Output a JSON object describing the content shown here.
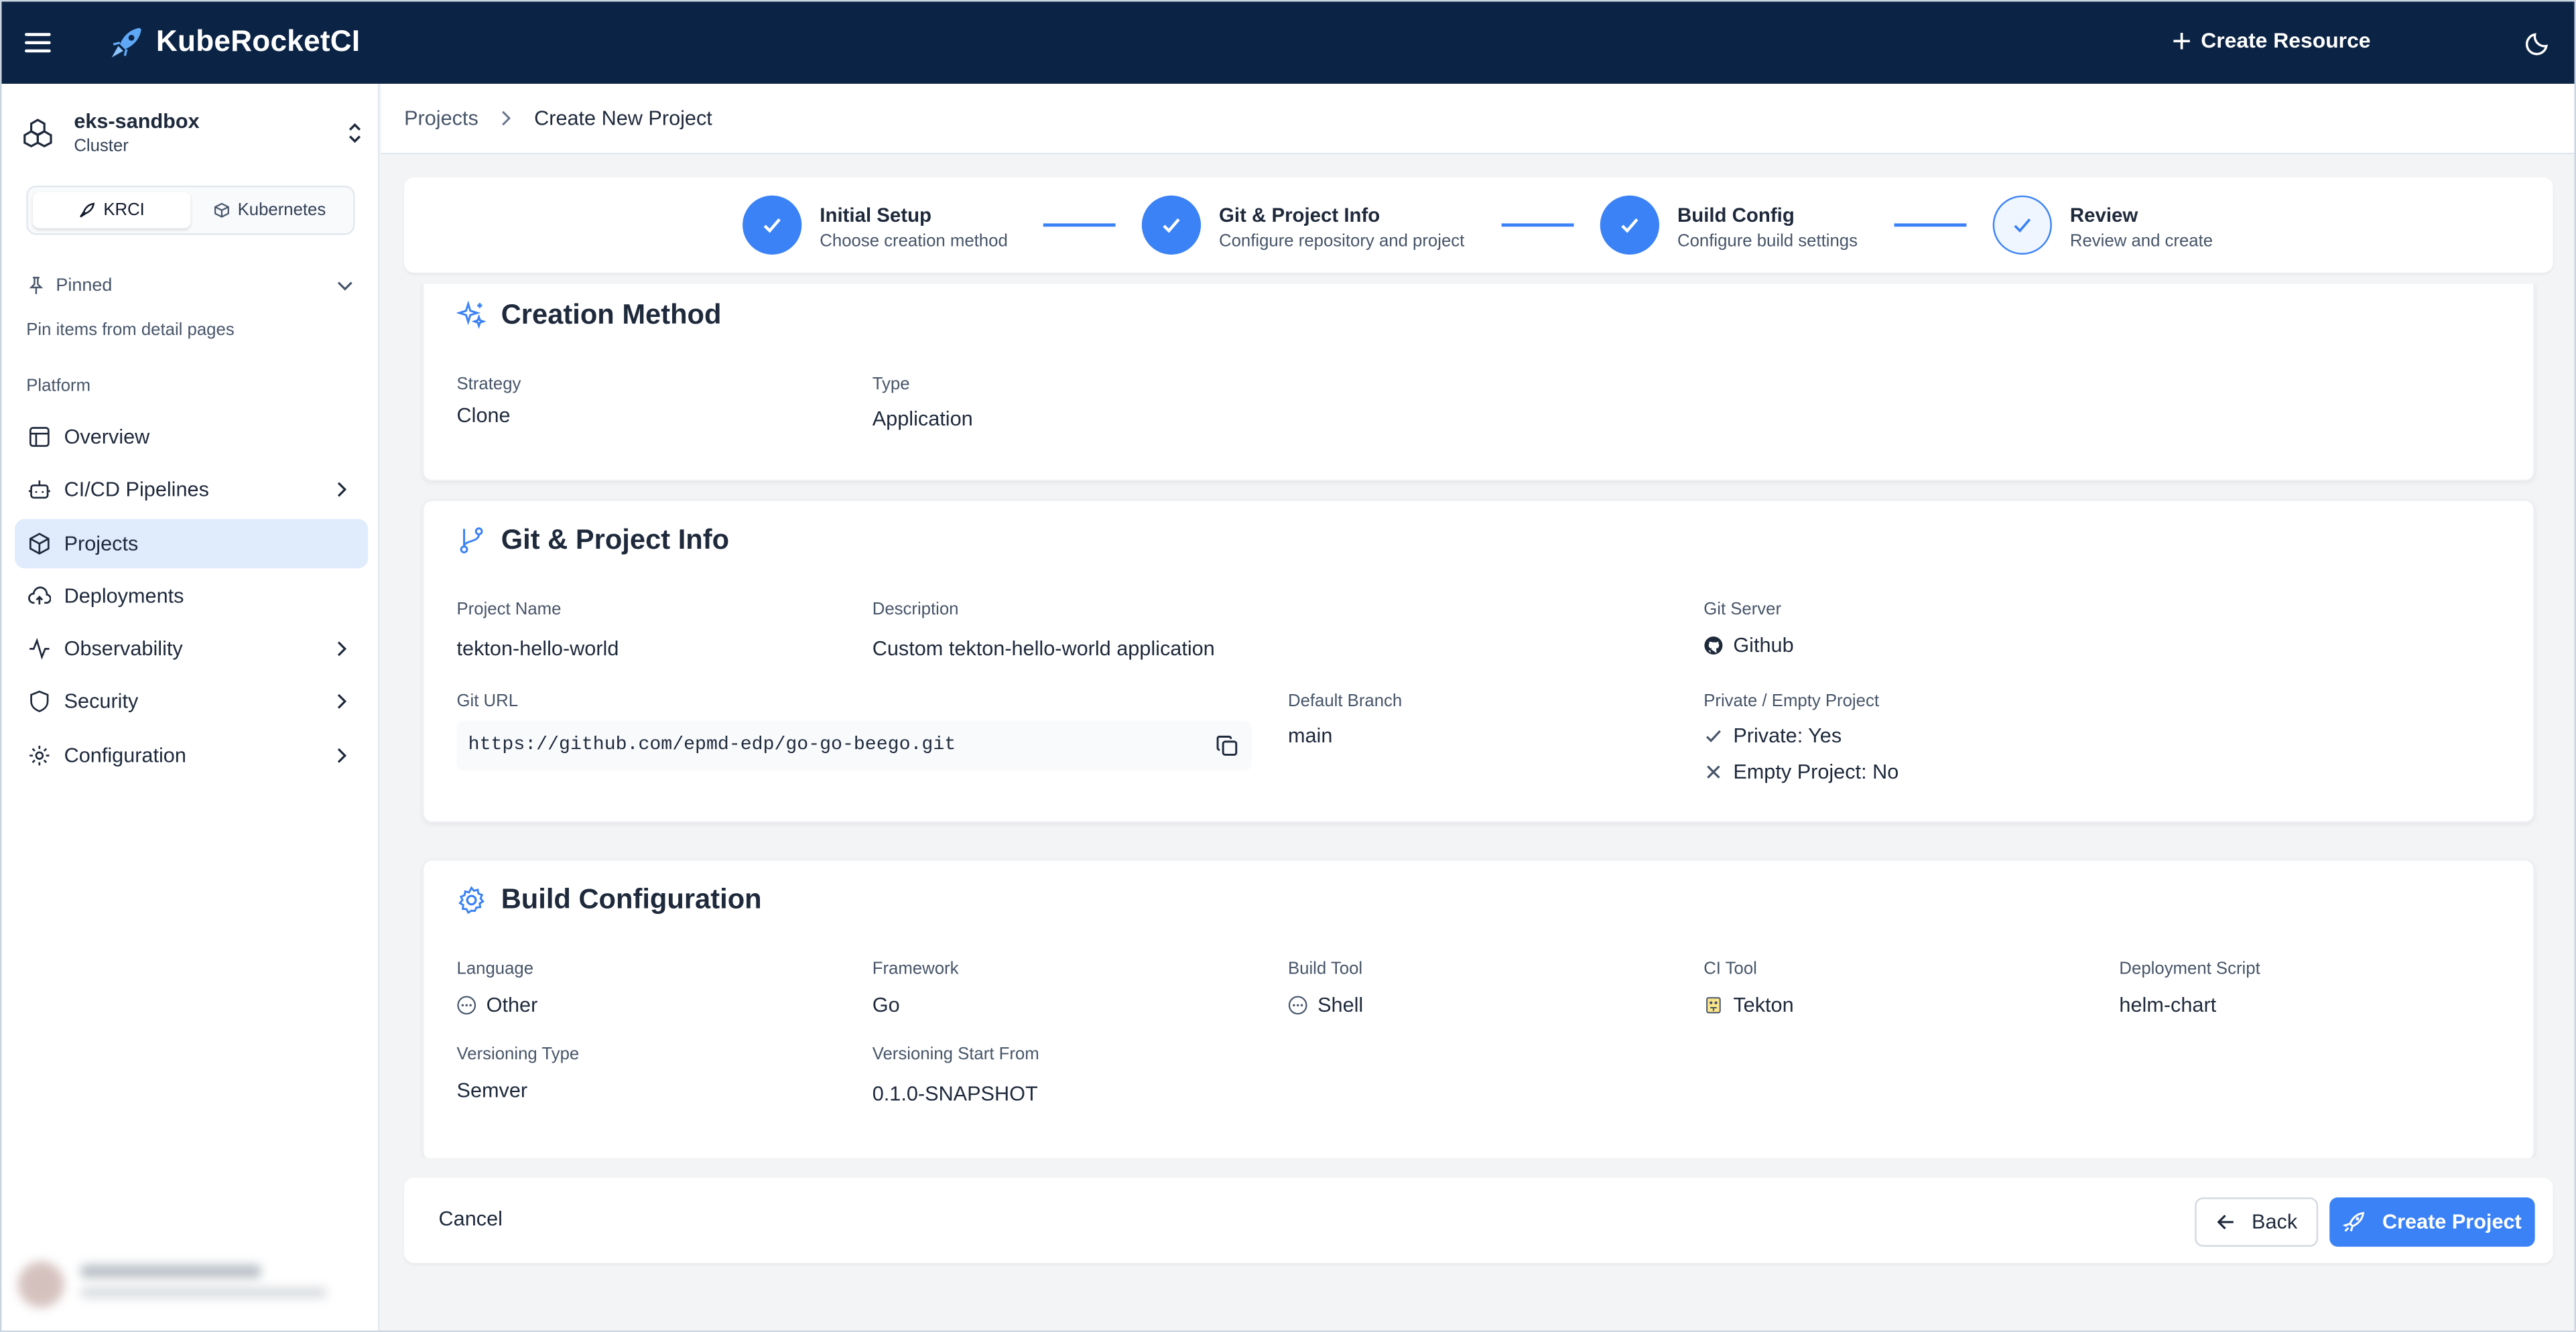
{
  "app": {
    "title": "KubeRocketCI",
    "create_resource": "Create Resource"
  },
  "cluster": {
    "name": "eks-sandbox",
    "type": "Cluster"
  },
  "mode_tabs": [
    {
      "label": "KRCI",
      "active": true
    },
    {
      "label": "Kubernetes",
      "active": false
    }
  ],
  "sidebar": {
    "pinned_label": "Pinned",
    "pinned_hint": "Pin items from detail pages",
    "section_label": "Platform",
    "items": [
      {
        "label": "Overview",
        "icon": "layout-icon",
        "has_children": false,
        "active": false
      },
      {
        "label": "CI/CD Pipelines",
        "icon": "bot-icon",
        "has_children": true,
        "active": false
      },
      {
        "label": "Projects",
        "icon": "box-icon",
        "has_children": false,
        "active": true
      },
      {
        "label": "Deployments",
        "icon": "cloud-upload-icon",
        "has_children": false,
        "active": false
      },
      {
        "label": "Observability",
        "icon": "activity-icon",
        "has_children": true,
        "active": false
      },
      {
        "label": "Security",
        "icon": "shield-icon",
        "has_children": true,
        "active": false
      },
      {
        "label": "Configuration",
        "icon": "gear-icon",
        "has_children": true,
        "active": false
      }
    ]
  },
  "breadcrumb": {
    "parent": "Projects",
    "current": "Create New Project"
  },
  "steps": [
    {
      "title": "Initial Setup",
      "subtitle": "Choose creation method",
      "state": "complete"
    },
    {
      "title": "Git & Project Info",
      "subtitle": "Configure repository and project",
      "state": "complete"
    },
    {
      "title": "Build Config",
      "subtitle": "Configure build settings",
      "state": "complete"
    },
    {
      "title": "Review",
      "subtitle": "Review and create",
      "state": "current"
    }
  ],
  "creation_method": {
    "title": "Creation Method",
    "strategy_label": "Strategy",
    "strategy": "Clone",
    "type_label": "Type",
    "type": "Application"
  },
  "git_info": {
    "title": "Git & Project Info",
    "project_name_label": "Project Name",
    "project_name": "tekton-hello-world",
    "description_label": "Description",
    "description": "Custom tekton-hello-world application",
    "git_server_label": "Git Server",
    "git_server": "Github",
    "git_url_label": "Git URL",
    "git_url": "https://github.com/epmd-edp/go-go-beego.git",
    "default_branch_label": "Default Branch",
    "default_branch": "main",
    "private_empty_label": "Private / Empty Project",
    "private": "Private: Yes",
    "empty": "Empty Project: No"
  },
  "build_config": {
    "title": "Build Configuration",
    "language_label": "Language",
    "language": "Other",
    "framework_label": "Framework",
    "framework": "Go",
    "build_tool_label": "Build Tool",
    "build_tool": "Shell",
    "ci_tool_label": "CI Tool",
    "ci_tool": "Tekton",
    "deployment_script_label": "Deployment Script",
    "deployment_script": "helm-chart",
    "versioning_type_label": "Versioning Type",
    "versioning_type": "Semver",
    "versioning_start_label": "Versioning Start From",
    "versioning_start": "0.1.0-SNAPSHOT"
  },
  "actions": {
    "cancel": "Cancel",
    "back": "Back",
    "create": "Create Project"
  },
  "colors": {
    "topbar": "#0b2344",
    "accent": "#3b82f6",
    "active_nav": "#e0ecfc"
  }
}
